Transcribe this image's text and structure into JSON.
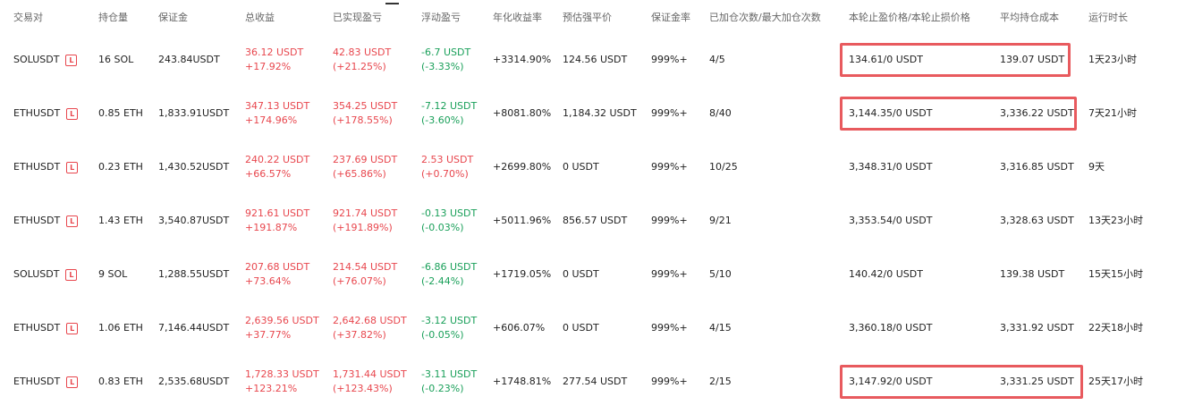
{
  "headers": [
    "交易对",
    "持仓量",
    "保证金",
    "总收益",
    "已实现盈亏",
    "浮动盈亏",
    "年化收益率",
    "预估强平价",
    "保证金率",
    "已加仓次数/最大加仓次数",
    "本轮止盈价格/本轮止损价格",
    "平均持仓成本",
    "运行时长"
  ],
  "badge": "L",
  "colors": {
    "profit": "#e8474e",
    "loss": "#1aa05a",
    "highlight": "#e85a5e"
  },
  "rows": [
    {
      "pair": "SOLUSDT",
      "qty": "16 SOL",
      "margin": "243.84USDT",
      "total": "36.12 USDT",
      "total_pct": "+17.92%",
      "realized": "42.83 USDT",
      "realized_pct": "(+21.25%)",
      "floating": "-6.7 USDT",
      "floating_pct": "(-3.33%)",
      "floating_color": "green",
      "annual": "+3314.90%",
      "liq": "124.56 USDT",
      "margin_rate": "999%+",
      "adds": "4/5",
      "tp_sl": "134.61/0 USDT",
      "avg_cost": "139.07 USDT",
      "runtime": "1天23小时"
    },
    {
      "pair": "ETHUSDT",
      "qty": "0.85 ETH",
      "margin": "1,833.91USDT",
      "total": "347.13 USDT",
      "total_pct": "+174.96%",
      "realized": "354.25 USDT",
      "realized_pct": "(+178.55%)",
      "floating": "-7.12 USDT",
      "floating_pct": "(-3.60%)",
      "floating_color": "green",
      "annual": "+8081.80%",
      "liq": "1,184.32 USDT",
      "margin_rate": "999%+",
      "adds": "8/40",
      "tp_sl": "3,144.35/0 USDT",
      "avg_cost": "3,336.22 USDT",
      "runtime": "7天21小时"
    },
    {
      "pair": "ETHUSDT",
      "qty": "0.23 ETH",
      "margin": "1,430.52USDT",
      "total": "240.22 USDT",
      "total_pct": "+66.57%",
      "realized": "237.69 USDT",
      "realized_pct": "(+65.86%)",
      "floating": "2.53 USDT",
      "floating_pct": "(+0.70%)",
      "floating_color": "red",
      "annual": "+2699.80%",
      "liq": "0 USDT",
      "margin_rate": "999%+",
      "adds": "10/25",
      "tp_sl": "3,348.31/0 USDT",
      "avg_cost": "3,316.85 USDT",
      "runtime": "9天"
    },
    {
      "pair": "ETHUSDT",
      "qty": "1.43 ETH",
      "margin": "3,540.87USDT",
      "total": "921.61 USDT",
      "total_pct": "+191.87%",
      "realized": "921.74 USDT",
      "realized_pct": "(+191.89%)",
      "floating": "-0.13 USDT",
      "floating_pct": "(-0.03%)",
      "floating_color": "green",
      "annual": "+5011.96%",
      "liq": "856.57 USDT",
      "margin_rate": "999%+",
      "adds": "9/21",
      "tp_sl": "3,353.54/0 USDT",
      "avg_cost": "3,328.63 USDT",
      "runtime": "13天23小时"
    },
    {
      "pair": "SOLUSDT",
      "qty": "9 SOL",
      "margin": "1,288.55USDT",
      "total": "207.68 USDT",
      "total_pct": "+73.64%",
      "realized": "214.54 USDT",
      "realized_pct": "(+76.07%)",
      "floating": "-6.86 USDT",
      "floating_pct": "(-2.44%)",
      "floating_color": "green",
      "annual": "+1719.05%",
      "liq": "0 USDT",
      "margin_rate": "999%+",
      "adds": "5/10",
      "tp_sl": "140.42/0 USDT",
      "avg_cost": "139.38 USDT",
      "runtime": "15天15小时"
    },
    {
      "pair": "ETHUSDT",
      "qty": "1.06 ETH",
      "margin": "7,146.44USDT",
      "total": "2,639.56 USDT",
      "total_pct": "+37.77%",
      "realized": "2,642.68 USDT",
      "realized_pct": "(+37.82%)",
      "floating": "-3.12 USDT",
      "floating_pct": "(-0.05%)",
      "floating_color": "green",
      "annual": "+606.07%",
      "liq": "0 USDT",
      "margin_rate": "999%+",
      "adds": "4/15",
      "tp_sl": "3,360.18/0 USDT",
      "avg_cost": "3,331.92 USDT",
      "runtime": "22天18小时"
    },
    {
      "pair": "ETHUSDT",
      "qty": "0.83 ETH",
      "margin": "2,535.68USDT",
      "total": "1,728.33 USDT",
      "total_pct": "+123.21%",
      "realized": "1,731.44 USDT",
      "realized_pct": "(+123.43%)",
      "floating": "-3.11 USDT",
      "floating_pct": "(-0.23%)",
      "floating_color": "green",
      "annual": "+1748.81%",
      "liq": "277.54 USDT",
      "margin_rate": "999%+",
      "adds": "2/15",
      "tp_sl": "3,147.92/0 USDT",
      "avg_cost": "3,331.25 USDT",
      "runtime": "25天17小时"
    }
  ]
}
